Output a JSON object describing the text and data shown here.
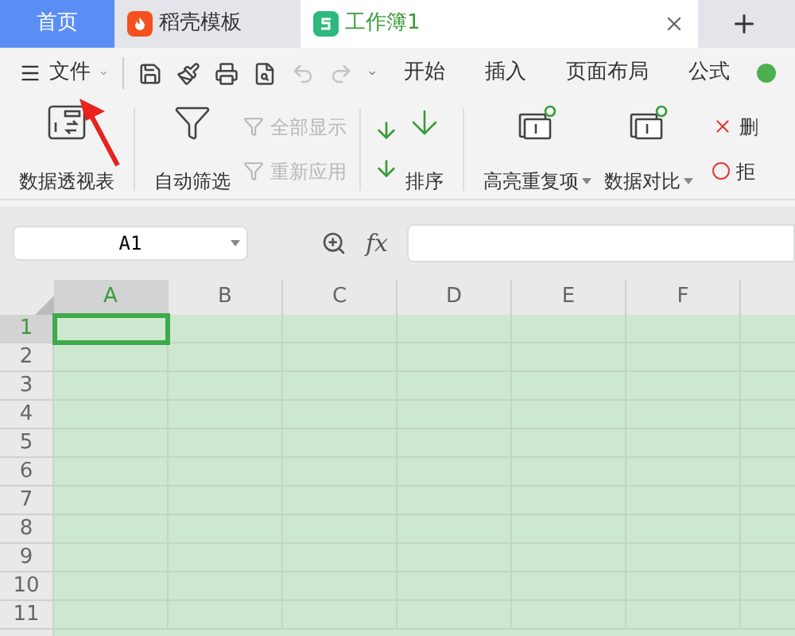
{
  "tabs": [
    {
      "label": "首页",
      "kind": "home",
      "selected": false
    },
    {
      "label": "稻壳模板",
      "kind": "docer",
      "selected": false
    },
    {
      "label": "工作簿1",
      "kind": "sheet",
      "selected": true
    }
  ],
  "menu": {
    "file": "文件",
    "tabs": [
      "开始",
      "插入",
      "页面布局",
      "公式"
    ]
  },
  "quick_access": [
    {
      "disabled": false
    },
    {
      "disabled": false
    },
    {
      "disabled": false
    },
    {
      "disabled": false
    },
    {
      "disabled": true
    },
    {
      "disabled": true
    }
  ],
  "ribbon": {
    "pivot": "数据透视表",
    "autofilter": "自动筛选",
    "show_all": {
      "label": "全部显示",
      "disabled": true
    },
    "reapply": {
      "label": "重新应用",
      "disabled": true
    },
    "sort": "排序",
    "highlight_dup": "高亮重复项",
    "compare": "数据对比",
    "delete": "删",
    "reject": "拒"
  },
  "formula_bar": {
    "cell_ref": "A1",
    "fx": "fx"
  },
  "columns": [
    {
      "label": "A",
      "selected": true
    },
    {
      "label": "B",
      "selected": false
    },
    {
      "label": "C",
      "selected": false
    },
    {
      "label": "D",
      "selected": false
    },
    {
      "label": "E",
      "selected": false
    },
    {
      "label": "F",
      "selected": false
    }
  ],
  "rows": [
    {
      "label": "1",
      "selected": true
    },
    {
      "label": "2",
      "selected": false
    },
    {
      "label": "3",
      "selected": false
    },
    {
      "label": "4",
      "selected": false
    },
    {
      "label": "5",
      "selected": false
    },
    {
      "label": "6",
      "selected": false
    },
    {
      "label": "7",
      "selected": false
    },
    {
      "label": "8",
      "selected": false
    },
    {
      "label": "9",
      "selected": false
    },
    {
      "label": "10",
      "selected": false
    },
    {
      "label": "11",
      "selected": false
    }
  ]
}
